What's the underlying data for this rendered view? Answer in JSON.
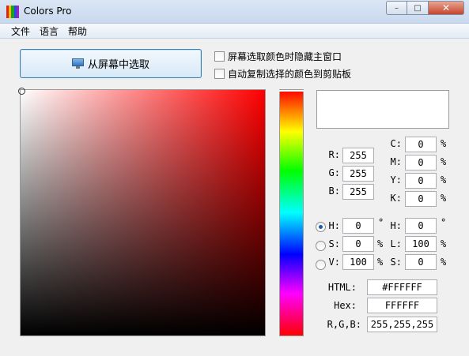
{
  "window": {
    "title": "Colors Pro",
    "minimize": "–",
    "maximize": "□",
    "close": "✕"
  },
  "app_icon_colors": [
    "#e02020",
    "#f0c000",
    "#20a020",
    "#2050e0",
    "#a020c0"
  ],
  "menu": [
    "文件",
    "语言",
    "帮助"
  ],
  "pick_button": {
    "label": "从屏幕中选取",
    "icon": "monitor-icon"
  },
  "options": [
    {
      "label": "屏幕选取颜色时隐藏主窗口",
      "checked": false
    },
    {
      "label": "自动复制选择的颜色到剪贴板",
      "checked": false
    }
  ],
  "current_color": "#FFFFFF",
  "hue_base_color": "#FF0000",
  "rgb": {
    "r_label": "R:",
    "r": "255",
    "g_label": "G:",
    "g": "255",
    "b_label": "B:",
    "b": "255"
  },
  "cmyk": {
    "c_label": "C:",
    "c": "0",
    "m_label": "M:",
    "m": "0",
    "y_label": "Y:",
    "y": "0",
    "k_label": "K:",
    "k": "0",
    "unit": "%"
  },
  "hsv": {
    "h_label": "H:",
    "h": "0",
    "h_unit": "°",
    "s_label": "S:",
    "s": "0",
    "s_unit": "%",
    "v_label": "V:",
    "v": "100",
    "v_unit": "%",
    "selected": "H"
  },
  "hls": {
    "h_label": "H:",
    "h": "0",
    "h_unit": "°",
    "l_label": "L:",
    "l": "100",
    "l_unit": "%",
    "s_label": "S:",
    "s": "0",
    "s_unit": "%"
  },
  "codes": {
    "html_label": "HTML:",
    "html": "#FFFFFF",
    "hex_label": "Hex:",
    "hex": "FFFFFF",
    "rgb_label": "R,G,B:",
    "rgb": "255,255,255"
  }
}
